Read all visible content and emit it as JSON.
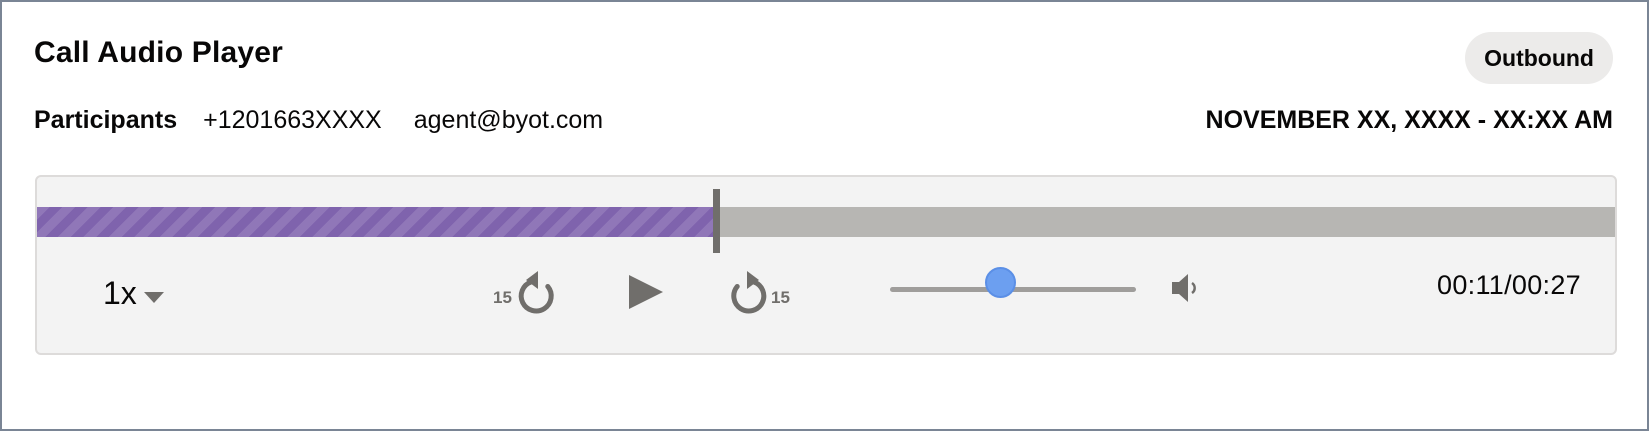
{
  "player": {
    "title": "Call Audio Player",
    "direction_badge": "Outbound",
    "participants_label": "Participants",
    "participants": [
      "+1201663XXXX",
      "agent@byot.com"
    ],
    "datetime": "NOVEMBER XX, XXXX - XX:XX AM"
  },
  "controls": {
    "speed": "1x",
    "rewind_seconds": "15",
    "forward_seconds": "15",
    "current_time": "00:11",
    "separator": "/",
    "total_time": "00:27",
    "progress_fraction": 0.43,
    "volume_fraction": 0.5
  },
  "icons": {
    "speed_dropdown": "caret-down-icon",
    "rewind": "rewind-15-icon",
    "play": "play-icon",
    "forward": "forward-15-icon",
    "volume": "speaker-icon"
  },
  "colors": {
    "progress_fill": "#7f63ad",
    "track": "#b7b6b3",
    "volume_thumb": "#6c9ff0",
    "badge_bg": "#ecebea"
  }
}
